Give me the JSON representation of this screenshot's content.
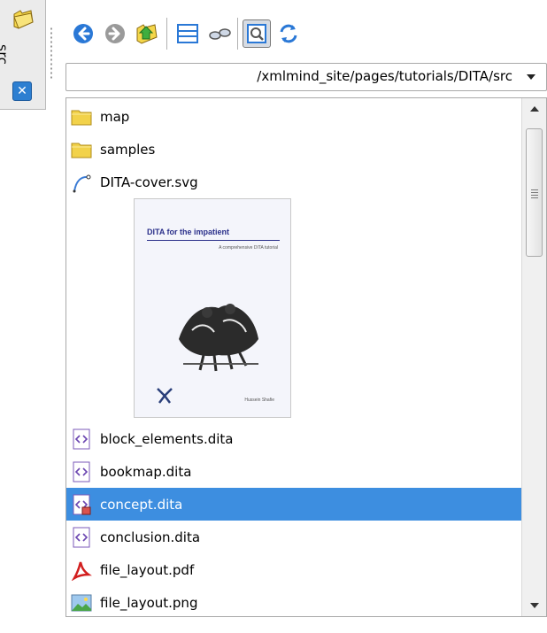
{
  "sidebar_tab": {
    "label": "src",
    "close_label": "✕",
    "folder_icon": "folder-icon"
  },
  "toolbar": {
    "buttons": [
      {
        "name": "back-button",
        "icon": "arrow-left-circle-icon"
      },
      {
        "name": "forward-button",
        "icon": "arrow-right-circle-icon"
      },
      {
        "name": "up-folder-button",
        "icon": "folder-up-icon"
      },
      {
        "name": "list-view-button",
        "icon": "list-icon"
      },
      {
        "name": "show-hidden-button",
        "icon": "glasses-icon"
      },
      {
        "name": "preview-button",
        "icon": "magnifier-icon",
        "pressed": true
      },
      {
        "name": "refresh-button",
        "icon": "refresh-icon"
      }
    ]
  },
  "path": {
    "value": "/xmlmind_site/pages/tutorials/DITA/src"
  },
  "files": {
    "items": [
      {
        "name": "map",
        "icon": "folder-icon"
      },
      {
        "name": "samples",
        "icon": "folder-icon"
      },
      {
        "name": "DITA-cover.svg",
        "icon": "svg-file-icon"
      },
      {
        "name": "block_elements.dita",
        "icon": "dita-file-icon"
      },
      {
        "name": "bookmap.dita",
        "icon": "dita-file-icon"
      },
      {
        "name": "concept.dita",
        "icon": "dita-file-locked-icon",
        "selected": true
      },
      {
        "name": "conclusion.dita",
        "icon": "dita-file-icon"
      },
      {
        "name": "file_layout.pdf",
        "icon": "pdf-file-icon"
      },
      {
        "name": "file_layout.png",
        "icon": "image-file-icon"
      }
    ]
  },
  "preview": {
    "cover_title": "DITA for the impatient",
    "cover_subtitle": "A comprehensive DITA tutorial",
    "author": "Hussein Shafie"
  },
  "scroll": {
    "position": 0.0,
    "visible_fraction": 0.27
  },
  "colors": {
    "selection": "#3d8ee0",
    "folder": "#f2d24a"
  }
}
